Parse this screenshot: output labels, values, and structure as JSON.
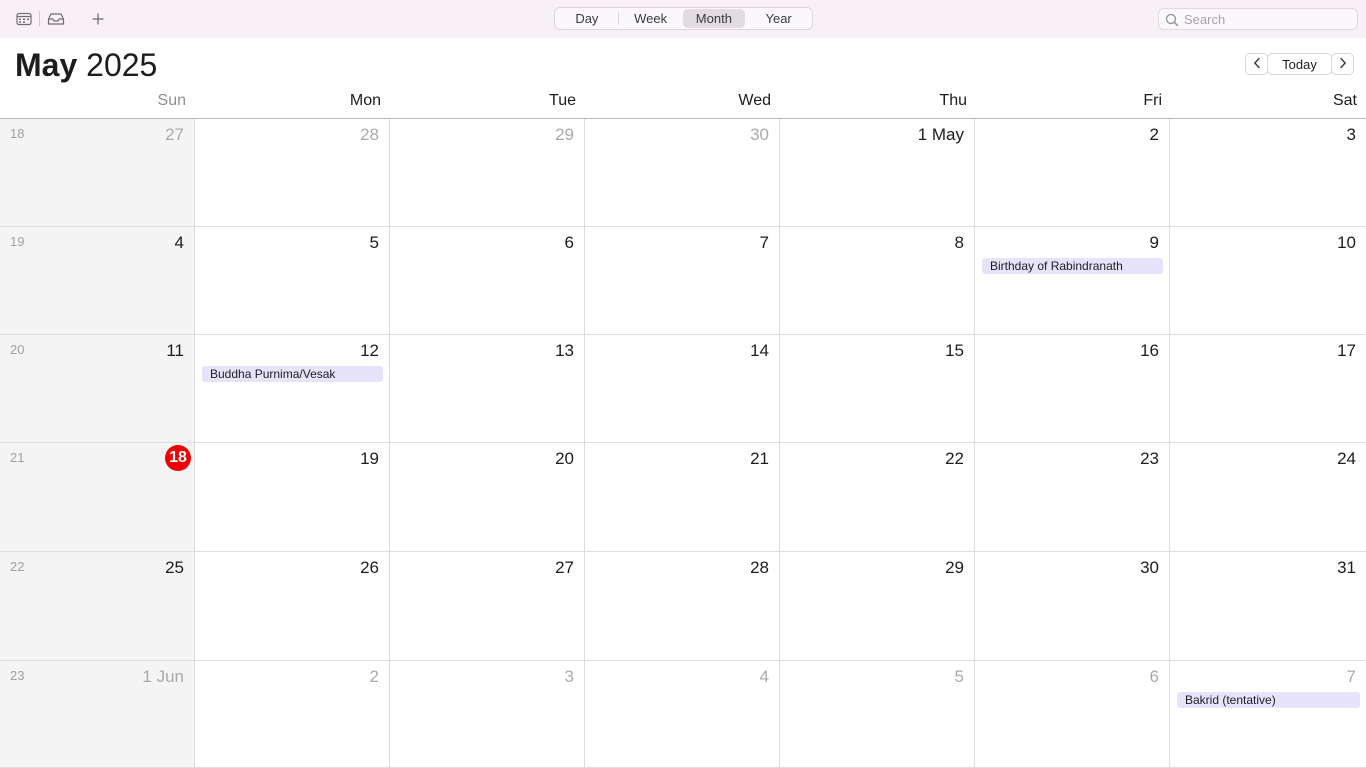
{
  "toolbar": {
    "icons": [
      "calendar-icon",
      "inbox-icon",
      "plus-icon"
    ],
    "views": [
      "Day",
      "Week",
      "Month",
      "Year"
    ],
    "active_view": "Month",
    "search_placeholder": "Search"
  },
  "header": {
    "month": "May",
    "year": "2025",
    "today_label": "Today"
  },
  "weekdays": [
    "Sun",
    "Mon",
    "Tue",
    "Wed",
    "Thu",
    "Fri",
    "Sat"
  ],
  "weeks": [
    {
      "week_number": "18",
      "days": [
        {
          "label": "27",
          "current_month": false
        },
        {
          "label": "28",
          "current_month": false
        },
        {
          "label": "29",
          "current_month": false
        },
        {
          "label": "30",
          "current_month": false
        },
        {
          "label": "1 May",
          "current_month": true
        },
        {
          "label": "2",
          "current_month": true
        },
        {
          "label": "3",
          "current_month": true
        }
      ]
    },
    {
      "week_number": "19",
      "days": [
        {
          "label": "4",
          "current_month": true
        },
        {
          "label": "5",
          "current_month": true
        },
        {
          "label": "6",
          "current_month": true
        },
        {
          "label": "7",
          "current_month": true
        },
        {
          "label": "8",
          "current_month": true
        },
        {
          "label": "9",
          "current_month": true,
          "events": [
            "Birthday of Rabindranath"
          ]
        },
        {
          "label": "10",
          "current_month": true
        }
      ]
    },
    {
      "week_number": "20",
      "days": [
        {
          "label": "11",
          "current_month": true
        },
        {
          "label": "12",
          "current_month": true,
          "events": [
            "Buddha Purnima/Vesak"
          ]
        },
        {
          "label": "13",
          "current_month": true
        },
        {
          "label": "14",
          "current_month": true
        },
        {
          "label": "15",
          "current_month": true
        },
        {
          "label": "16",
          "current_month": true
        },
        {
          "label": "17",
          "current_month": true
        }
      ]
    },
    {
      "week_number": "21",
      "days": [
        {
          "label": "18",
          "current_month": true,
          "today": true
        },
        {
          "label": "19",
          "current_month": true
        },
        {
          "label": "20",
          "current_month": true
        },
        {
          "label": "21",
          "current_month": true
        },
        {
          "label": "22",
          "current_month": true
        },
        {
          "label": "23",
          "current_month": true
        },
        {
          "label": "24",
          "current_month": true
        }
      ]
    },
    {
      "week_number": "22",
      "days": [
        {
          "label": "25",
          "current_month": true
        },
        {
          "label": "26",
          "current_month": true
        },
        {
          "label": "27",
          "current_month": true
        },
        {
          "label": "28",
          "current_month": true
        },
        {
          "label": "29",
          "current_month": true
        },
        {
          "label": "30",
          "current_month": true
        },
        {
          "label": "31",
          "current_month": true
        }
      ]
    },
    {
      "week_number": "23",
      "days": [
        {
          "label": "1 Jun",
          "current_month": false
        },
        {
          "label": "2",
          "current_month": false
        },
        {
          "label": "3",
          "current_month": false
        },
        {
          "label": "4",
          "current_month": false
        },
        {
          "label": "5",
          "current_month": false
        },
        {
          "label": "6",
          "current_month": false
        },
        {
          "label": "7",
          "current_month": false,
          "events": [
            "Bakrid (tentative)"
          ]
        }
      ]
    }
  ],
  "colors": {
    "today_badge": "#ee0000",
    "event_background": "#e6e3fb",
    "toolbar_background": "#f7f0f7"
  }
}
